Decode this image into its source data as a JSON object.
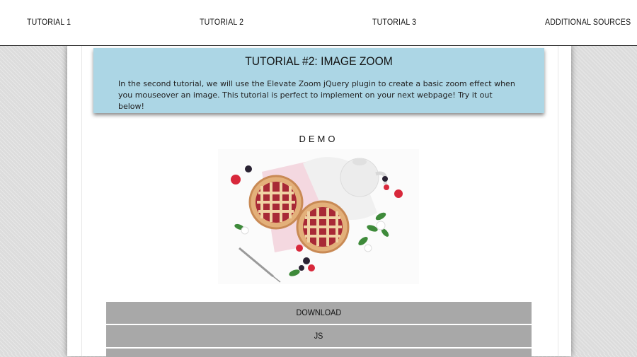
{
  "nav": {
    "items": [
      {
        "label": "TUTORIAL 1"
      },
      {
        "label": "TUTORIAL 2"
      },
      {
        "label": "TUTORIAL 3"
      },
      {
        "label": "ADDITIONAL SOURCES"
      }
    ]
  },
  "intro": {
    "title": "TUTORIAL #2: IMAGE ZOOM",
    "body": "In the second tutorial, we will use the Elevate Zoom jQuery plugin to create a basic zoom effect when you mouseover an image. This tutorial is perfect to implement on your next webpage! Try it out below!"
  },
  "demo": {
    "label": "DEMO"
  },
  "buttons": {
    "download": "DOWNLOAD",
    "js": "JS"
  },
  "colors": {
    "intro_bg": "#acd6e5",
    "button_bg": "#a8a8a8"
  }
}
